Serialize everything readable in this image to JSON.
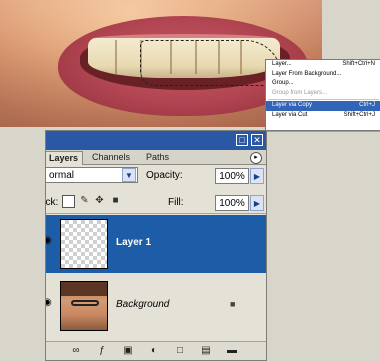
{
  "menu": {
    "items": [
      {
        "label": "Layer...",
        "shortcut": "Shift+Ctrl+N",
        "state": "normal"
      },
      {
        "label": "Layer From Background...",
        "shortcut": "",
        "state": "normal"
      },
      {
        "label": "Group...",
        "shortcut": "",
        "state": "normal"
      },
      {
        "label": "Group from Layers...",
        "shortcut": "",
        "state": "disabled"
      },
      {
        "label": "Layer via Copy",
        "shortcut": "Ctrl+J",
        "state": "selected"
      },
      {
        "label": "Layer via Cut",
        "shortcut": "Shift+Ctrl+J",
        "state": "normal"
      }
    ]
  },
  "panel": {
    "tabs": [
      "Layers",
      "Channels",
      "Paths"
    ],
    "active_tab": "Layers",
    "blend_mode": "ormal",
    "opacity_label": "Opacity:",
    "opacity_value": "100%",
    "lock_label": "ock:",
    "fill_label": "Fill:",
    "fill_value": "100%",
    "layers": [
      {
        "name": "Layer 1",
        "selected": true
      },
      {
        "name": "Background",
        "selected": false
      }
    ]
  },
  "icons": {
    "eye": "eye-icon",
    "lock": "lock-icon",
    "link": "link-layers-icon",
    "style": "layer-style-icon",
    "mask": "add-mask-icon",
    "adjust": "adjustment-layer-icon",
    "group": "new-group-icon",
    "new": "new-layer-icon",
    "trash": "delete-layer-icon"
  },
  "colors": {
    "selection_blue": "#1d5ca6",
    "titlebar_blue": "#2a58a5",
    "menu_highlight": "#3265b8"
  }
}
